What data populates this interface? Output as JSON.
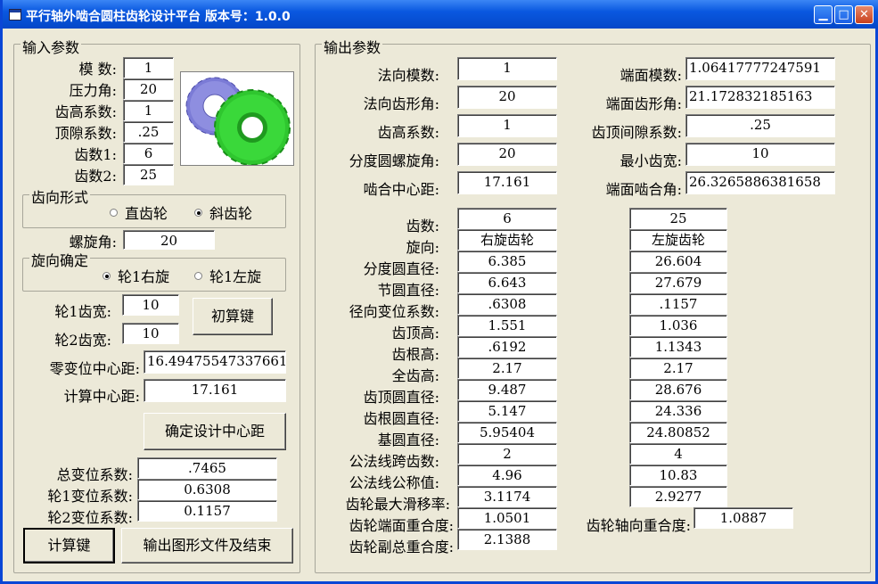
{
  "window": {
    "title": "平行轴外啮合圆柱齿轮设计平台 版本号：1.0.0"
  },
  "input": {
    "group_title": "输入参数",
    "fields": [
      {
        "label": "模  数:",
        "value": "1"
      },
      {
        "label": "压力角:",
        "value": "20"
      },
      {
        "label": "齿高系数:",
        "value": "1"
      },
      {
        "label": "顶隙系数:",
        "value": ".25"
      },
      {
        "label": "齿数1:",
        "value": "6"
      },
      {
        "label": "齿数2:",
        "value": "25"
      }
    ],
    "tooth_dir": {
      "title": "齿向形式",
      "opt1": "直齿轮",
      "opt2": "斜齿轮",
      "selected": "斜齿轮"
    },
    "helix_label": "螺旋角:",
    "helix_value": "20",
    "rot_dir": {
      "title": "旋向确定",
      "opt1": "轮1右旋",
      "opt2": "轮1左旋",
      "selected": "轮1右旋"
    },
    "width1_label": "轮1齿宽:",
    "width1_value": "10",
    "width2_label": "轮2齿宽:",
    "width2_value": "10",
    "init_button": "初算键",
    "zero_center_label": "零变位中心距:",
    "zero_center_value": "16.49475547337661",
    "calc_center_label": "计算中心距:",
    "calc_center_value": "17.161",
    "confirm_button": "确定设计中心距",
    "total_shift_label": "总变位系数:",
    "total_shift_value": ".7465",
    "shift1_label": "轮1变位系数:",
    "shift1_value": "0.6308",
    "shift2_label": "轮2变位系数:",
    "shift2_value": "0.1157",
    "calc_button": "计算键",
    "export_button": "输出图形文件及结束"
  },
  "output": {
    "group_title": "输出参数",
    "left": [
      {
        "label": "法向模数:",
        "value": "1"
      },
      {
        "label": "法向齿形角:",
        "value": "20"
      },
      {
        "label": "齿高系数:",
        "value": "1"
      },
      {
        "label": "分度圆螺旋角:",
        "value": "20"
      },
      {
        "label": "啮合中心距:",
        "value": "17.161"
      }
    ],
    "right": [
      {
        "label": "端面模数:",
        "value": "1.06417777247591"
      },
      {
        "label": "端面齿形角:",
        "value": "21.172832185163"
      },
      {
        "label": "齿顶间隙系数:",
        "value": ".25"
      },
      {
        "label": "最小齿宽:",
        "value": "10"
      },
      {
        "label": "端面啮合角:",
        "value": "26.3265886381658"
      }
    ],
    "rows": [
      {
        "label": "齿数:",
        "g1": "6",
        "g2": "25"
      },
      {
        "label": "旋向:",
        "g1": "右旋齿轮",
        "g2": "左旋齿轮"
      },
      {
        "label": "分度圆直径:",
        "g1": "6.385",
        "g2": "26.604"
      },
      {
        "label": "节圆直径:",
        "g1": "6.643",
        "g2": "27.679"
      },
      {
        "label": "径向变位系数:",
        "g1": ".6308",
        "g2": ".1157"
      },
      {
        "label": "齿顶高:",
        "g1": "1.551",
        "g2": "1.036"
      },
      {
        "label": "齿根高:",
        "g1": ".6192",
        "g2": "1.1343"
      },
      {
        "label": "全齿高:",
        "g1": "2.17",
        "g2": "2.17"
      },
      {
        "label": "齿顶圆直径:",
        "g1": "9.487",
        "g2": "28.676"
      },
      {
        "label": "齿根圆直径:",
        "g1": "5.147",
        "g2": "24.336"
      },
      {
        "label": "基圆直径:",
        "g1": "5.95404",
        "g2": "24.80852"
      },
      {
        "label": "公法线跨齿数:",
        "g1": "2",
        "g2": "4"
      },
      {
        "label": "公法线公称值:",
        "g1": "4.96",
        "g2": "10.83"
      },
      {
        "label": "齿轮最大滑移率:",
        "g1": "3.1174",
        "g2": "2.9277"
      }
    ],
    "transverse_label": "齿轮端面重合度:",
    "transverse_value": "1.0501",
    "axial_label": "齿轮轴向重合度:",
    "axial_value": "1.0887",
    "total_label": "齿轮副总重合度:",
    "total_value": "2.1388"
  },
  "colors": {
    "titlebar": "#0a58e0",
    "window_bg": "#ece9d8",
    "gear1": "#7b7bd6",
    "gear2": "#2fc62f"
  }
}
